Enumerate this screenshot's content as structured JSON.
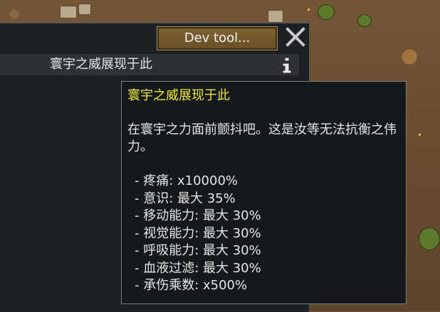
{
  "window": {
    "dev_tool_label": "Dev tool...",
    "title": "寰宇之威展现于此"
  },
  "tooltip": {
    "title": "寰宇之威展现于此",
    "description": "在寰宇之力面前颤抖吧。这是汝等无法抗衡之伟力。",
    "stats": [
      "- 疼痛: x10000%",
      "- 意识: 最大 35%",
      "- 移动能力: 最大 30%",
      "- 视觉能力: 最大 30%",
      "- 呼吸能力: 最大 30%",
      "- 血液过滤: 最大 30%",
      "- 承伤乘数: x500%"
    ]
  },
  "colors": {
    "tooltip_title": "#ece83c",
    "button_brown": "#7d6132",
    "panel_dark": "#1c2124"
  },
  "icons": [
    "close-icon",
    "info-icon"
  ]
}
